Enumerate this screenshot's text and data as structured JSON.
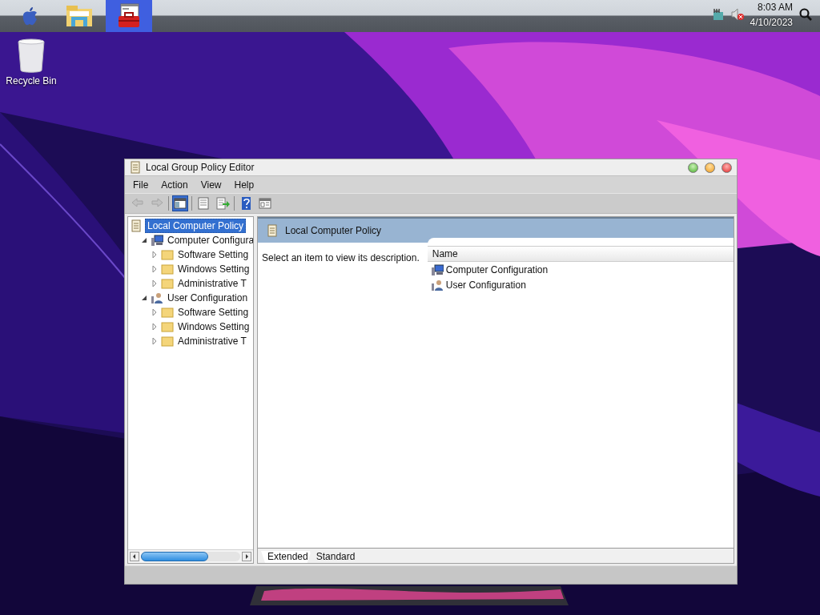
{
  "top_bar": {
    "apps": [
      {
        "kind": "apple",
        "selected": false
      },
      {
        "kind": "folder",
        "selected": false
      },
      {
        "kind": "toolbox",
        "selected": true
      }
    ],
    "tray": {
      "time": "8:03 AM",
      "date": "4/10/2023"
    }
  },
  "desktop_icons": [
    {
      "kind": "bin",
      "label": "Recycle Bin"
    }
  ],
  "window": {
    "title": "Local Group Policy Editor",
    "menu": [
      "File",
      "Action",
      "View",
      "Help"
    ],
    "toolbar": [
      {
        "kind": "back",
        "disabled": true
      },
      {
        "kind": "forward",
        "disabled": true
      },
      {
        "kind": "separator"
      },
      {
        "kind": "tree",
        "selected": true
      },
      {
        "kind": "separator"
      },
      {
        "kind": "list",
        "selected": false
      },
      {
        "kind": "export",
        "selected": false
      },
      {
        "kind": "separator"
      },
      {
        "kind": "help",
        "selected": false
      },
      {
        "kind": "view",
        "selected": false
      }
    ],
    "tree": [
      {
        "kind": "policy",
        "label": "Local Computer Policy",
        "selected": true,
        "children": [
          {
            "kind": "computer",
            "label": "Computer Configura",
            "expanded": true,
            "selected": false,
            "children": [
              {
                "kind": "folder",
                "label": "Software Setting",
                "expanded": false,
                "selected": false
              },
              {
                "kind": "folder",
                "label": "Windows Setting",
                "expanded": false,
                "selected": false
              },
              {
                "kind": "folder",
                "label": "Administrative T",
                "expanded": false,
                "selected": false
              }
            ]
          },
          {
            "kind": "user",
            "label": "User Configuration",
            "expanded": true,
            "selected": false,
            "children": [
              {
                "kind": "folder",
                "label": "Software Setting",
                "expanded": false,
                "selected": false
              },
              {
                "kind": "folder",
                "label": "Windows Setting",
                "expanded": false,
                "selected": false
              },
              {
                "kind": "folder",
                "label": "Administrative T",
                "expanded": false,
                "selected": false
              }
            ]
          }
        ]
      }
    ],
    "content": {
      "title": "Local Computer Policy",
      "description": "Select an item to view its description.",
      "columns": [
        "Name"
      ],
      "rows": [
        {
          "kind": "computer",
          "name": "Computer Configuration"
        },
        {
          "kind": "user",
          "name": "User Configuration"
        }
      ]
    },
    "tabs": [
      {
        "label": "Extended",
        "selected": true
      },
      {
        "label": "Standard",
        "selected": false
      }
    ]
  }
}
